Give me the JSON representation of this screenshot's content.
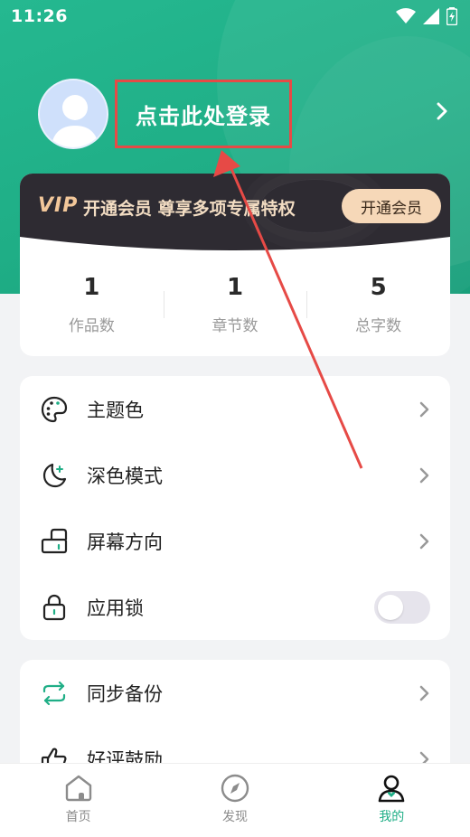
{
  "status_bar": {
    "time": "11:26"
  },
  "profile": {
    "login_text": "点击此处登录"
  },
  "vip": {
    "logo": "VIP",
    "text": "开通会员 尊享多项专属特权",
    "button": "开通会员"
  },
  "stats": [
    {
      "value": "1",
      "label": "作品数"
    },
    {
      "value": "1",
      "label": "章节数"
    },
    {
      "value": "5",
      "label": "总字数"
    }
  ],
  "menu1": [
    {
      "label": "主题色",
      "icon": "palette-icon",
      "control": "chevron"
    },
    {
      "label": "深色模式",
      "icon": "moon-icon",
      "control": "chevron"
    },
    {
      "label": "屏幕方向",
      "icon": "screen-rotation-icon",
      "control": "chevron"
    },
    {
      "label": "应用锁",
      "icon": "lock-icon",
      "control": "toggle",
      "toggle_on": false
    }
  ],
  "menu2": [
    {
      "label": "同步备份",
      "icon": "sync-icon",
      "control": "chevron"
    },
    {
      "label": "好评鼓励",
      "icon": "thumbs-up-icon",
      "control": "chevron"
    }
  ],
  "tabs": [
    {
      "label": "首页",
      "icon": "home-icon",
      "active": false
    },
    {
      "label": "发现",
      "icon": "compass-icon",
      "active": false
    },
    {
      "label": "我的",
      "icon": "profile-icon",
      "active": true
    }
  ],
  "colors": {
    "primary": "#1fae86",
    "vip_bg": "#2e2b32",
    "vip_gold": "#f6d8b8",
    "highlight": "#e64a46"
  }
}
